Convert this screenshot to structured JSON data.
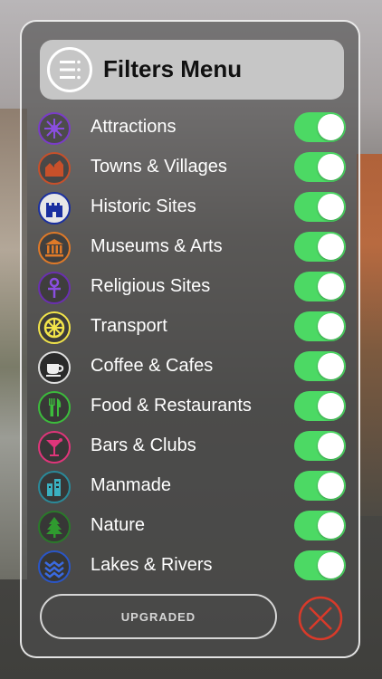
{
  "header": {
    "title": "Filters Menu",
    "icon": "menu-list-icon"
  },
  "filters": [
    {
      "label": "Attractions",
      "icon": "attractions-icon",
      "color": "#7a3cc8",
      "on": true
    },
    {
      "label": "Towns & Villages",
      "icon": "towns-icon",
      "color": "#c8502a",
      "on": true
    },
    {
      "label": "Historic Sites",
      "icon": "castle-icon",
      "color": "#1a2fa0",
      "on": true
    },
    {
      "label": "Museums & Arts",
      "icon": "museum-icon",
      "color": "#e07a28",
      "on": true
    },
    {
      "label": "Religious Sites",
      "icon": "ankh-icon",
      "color": "#6a2fb0",
      "on": true
    },
    {
      "label": "Transport",
      "icon": "wheel-icon",
      "color": "#f2e44a",
      "on": true
    },
    {
      "label": "Coffee & Cafes",
      "icon": "coffee-cup-icon",
      "color": "#222222",
      "on": true
    },
    {
      "label": "Food & Restaurants",
      "icon": "cutlery-icon",
      "color": "#3cbc3c",
      "on": true
    },
    {
      "label": "Bars & Clubs",
      "icon": "cocktail-icon",
      "color": "#e0357a",
      "on": true
    },
    {
      "label": "Manmade",
      "icon": "buildings-icon",
      "color": "#2a8a9a",
      "on": true
    },
    {
      "label": "Nature",
      "icon": "tree-icon",
      "color": "#2a7a2a",
      "on": true
    },
    {
      "label": "Lakes & Rivers",
      "icon": "waves-icon",
      "color": "#2a56c8",
      "on": true
    }
  ],
  "footer": {
    "upgraded_label": "UPGRADED",
    "close_icon": "close-x-icon",
    "close_color": "#d83a2a"
  },
  "colors": {
    "toggle_on": "#4cd964"
  }
}
